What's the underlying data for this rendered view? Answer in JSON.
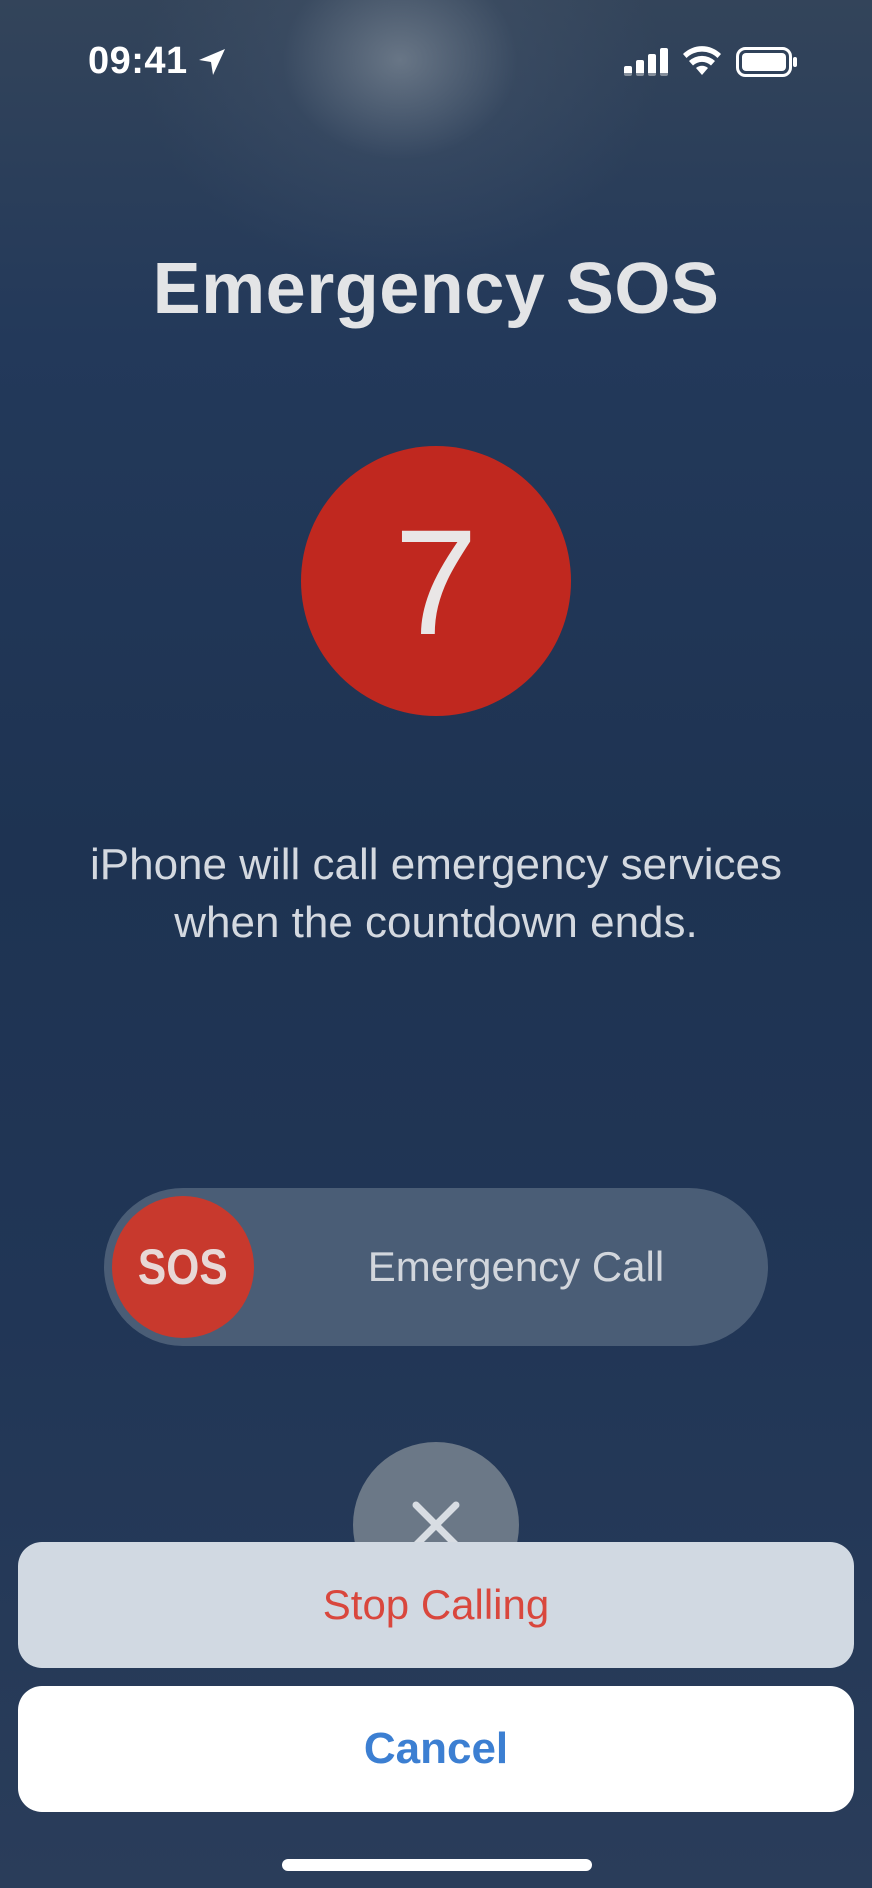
{
  "status_bar": {
    "time": "09:41",
    "icons": [
      "location-arrow-icon",
      "cellular-signal-icon",
      "wifi-icon",
      "battery-icon"
    ]
  },
  "screen": {
    "title": "Emergency SOS",
    "countdown": "7",
    "message_line1": "iPhone will call emergency services",
    "message_line2": "when the countdown ends."
  },
  "slider": {
    "knob_label": "SOS",
    "label": "Emergency Call"
  },
  "cancel_circle": {
    "icon": "close-icon"
  },
  "action_sheet": {
    "stop_label": "Stop Calling",
    "cancel_label": "Cancel"
  },
  "colors": {
    "sos_red": "#c0281f",
    "stop_text": "#d9473d",
    "cancel_text": "#3c7fd2",
    "background": "#1e3352"
  }
}
